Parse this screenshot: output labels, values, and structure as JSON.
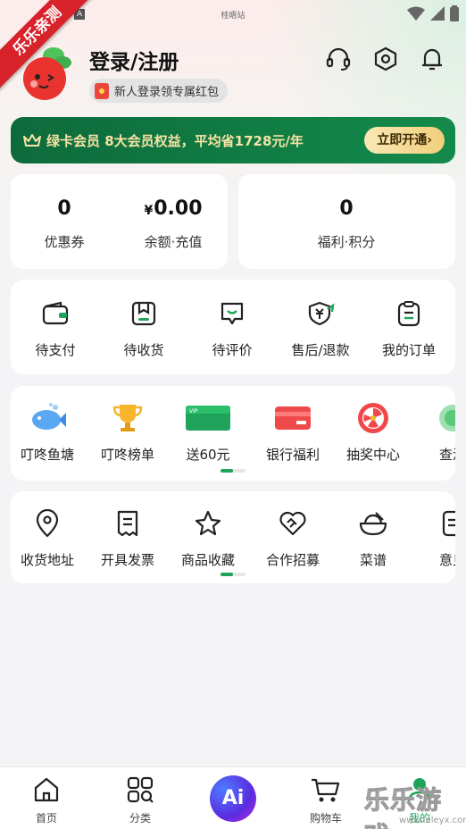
{
  "status": {
    "center": "桂晤站",
    "a_icon": "A"
  },
  "watermark": {
    "ribbon": "乐乐亲测",
    "logo": "乐乐游戏",
    "url": "www.leleyx.com"
  },
  "header": {
    "title": "登录/注册",
    "promo": "新人登录领专属红包",
    "icons": [
      "headset-icon",
      "settings-hexagon-icon",
      "bell-icon"
    ]
  },
  "membership": {
    "text": "绿卡会员 8大会员权益，平均省1728元/年",
    "button": "立即开通›"
  },
  "wallet": {
    "coupons": {
      "value": "0",
      "label": "优惠券"
    },
    "balance": {
      "currency": "¥",
      "value": "0.00",
      "label": "余额·充值"
    },
    "points": {
      "value": "0",
      "label": "福利·积分"
    }
  },
  "orders": {
    "items": [
      {
        "label": "待支付",
        "icon": "wallet-icon"
      },
      {
        "label": "待收货",
        "icon": "package-icon"
      },
      {
        "label": "待评价",
        "icon": "comment-icon"
      },
      {
        "label": "售后/退款",
        "icon": "refund-icon"
      },
      {
        "label": "我的订单",
        "icon": "clipboard-icon"
      }
    ]
  },
  "features": {
    "items": [
      {
        "label": "叮咚鱼塘",
        "icon": "fish-icon"
      },
      {
        "label": "叮咚榜单",
        "icon": "trophy-icon"
      },
      {
        "label": "送60元",
        "icon": "vip-card-icon"
      },
      {
        "label": "银行福利",
        "icon": "bank-card-icon"
      },
      {
        "label": "抽奖中心",
        "icon": "lottery-icon"
      },
      {
        "label": "查添",
        "icon": "green-circle-icon"
      }
    ]
  },
  "services": {
    "items": [
      {
        "label": "收货地址",
        "icon": "location-icon"
      },
      {
        "label": "开具发票",
        "icon": "invoice-icon"
      },
      {
        "label": "商品收藏",
        "icon": "star-icon"
      },
      {
        "label": "合作招募",
        "icon": "handshake-icon"
      },
      {
        "label": "菜谱",
        "icon": "bowl-icon"
      },
      {
        "label": "意见",
        "icon": "feedback-icon"
      }
    ]
  },
  "bottom_nav": {
    "home": "首页",
    "category": "分类",
    "ai": "Ai",
    "cart": "购物车",
    "mine": "我的"
  },
  "colors": {
    "brand_green": "#148a4a",
    "accent_gold": "#f1cf7c",
    "promo_red": "#e9473a"
  }
}
